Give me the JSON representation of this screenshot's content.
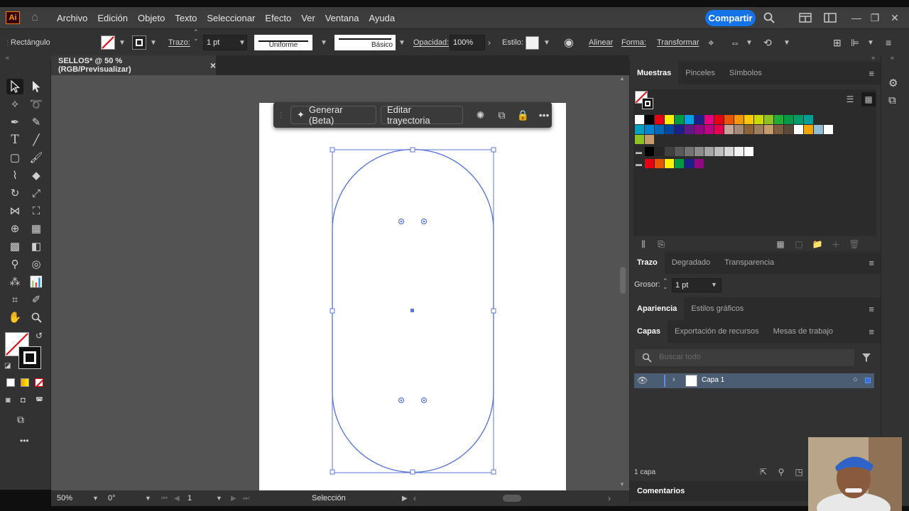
{
  "app": {
    "logo": "Ai",
    "menu": [
      "Archivo",
      "Edición",
      "Objeto",
      "Texto",
      "Seleccionar",
      "Efecto",
      "Ver",
      "Ventana",
      "Ayuda"
    ],
    "share_label": "Compartir"
  },
  "control": {
    "object_type": "Rectángulo",
    "stroke_label": "Trazo:",
    "stroke_value": "1 pt",
    "profile_label": "Uniforme",
    "brush_label": "Básico",
    "opacity_label": "Opacidad:",
    "opacity_value": "100%",
    "style_label": "Estilo:",
    "align_label": "Alinear",
    "shape_label": "Forma:",
    "transform_label": "Transformar"
  },
  "document": {
    "tab_title": "SELLOS* @ 50 % (RGB/Previsualizar)",
    "close_glyph": "×"
  },
  "context_bar": {
    "generate_label": "Generar (Beta)",
    "edit_path_label": "Editar trayectoria",
    "more_glyph": "•••"
  },
  "status": {
    "zoom": "50%",
    "rotation": "0°",
    "artboard_index": "1",
    "tool_name": "Selección"
  },
  "panels": {
    "swatches_tabs": [
      "Muestras",
      "Pinceles",
      "Símbolos"
    ],
    "stroke_tabs": [
      "Trazo",
      "Degradado",
      "Transparencia"
    ],
    "weight_label": "Grosor:",
    "weight_value": "1 pt",
    "appearance_tabs": [
      "Apariencia",
      "Estilos gráficos"
    ],
    "layers_tabs": [
      "Capas",
      "Exportación de recursos",
      "Mesas de trabajo"
    ],
    "search_placeholder": "Buscar todo",
    "layer_name": "Capa 1",
    "layer_count": "1 capa",
    "comments_label": "Comentarios"
  },
  "colors": {
    "accent": "#1473e6",
    "path": "#5b78d6",
    "canvas": "#535353"
  },
  "swatches": {
    "row1": [
      "#ffffff",
      "#000000",
      "#e60012",
      "#fff100",
      "#009944",
      "#00a0e9",
      "#1d2088",
      "#e4007f",
      "#e60012",
      "#ea5504",
      "#f39800",
      "#fcc800",
      "#cfdb00",
      "#8fc31f",
      "#22ac38",
      "#009944",
      "#009b6b",
      "#009e96"
    ],
    "row2": [
      "#00a0c1",
      "#0086d1",
      "#0068b7",
      "#00479d",
      "#1d2088",
      "#601986",
      "#920783",
      "#be0081",
      "#e5004f",
      "#c4a69a",
      "#a48b78",
      "#8c6239",
      "#9e7e5c",
      "#c69c6d",
      "#7d5f3f",
      "#5b4a3a",
      "#ffffff",
      "#f0a500",
      "#8fbdd6",
      "#ffffff"
    ],
    "row3": [
      "#8fc31f",
      "#c69c6d"
    ],
    "row4": [
      "#000000",
      "#262626",
      "#404040",
      "#595959",
      "#737373",
      "#8c8c8c",
      "#a6a6a6",
      "#bfbfbf",
      "#d9d9d9",
      "#f2f2f2",
      "#ffffff"
    ],
    "row5": [
      "#e60012",
      "#ea5504",
      "#fff100",
      "#009944",
      "#1d2088",
      "#920783"
    ]
  }
}
